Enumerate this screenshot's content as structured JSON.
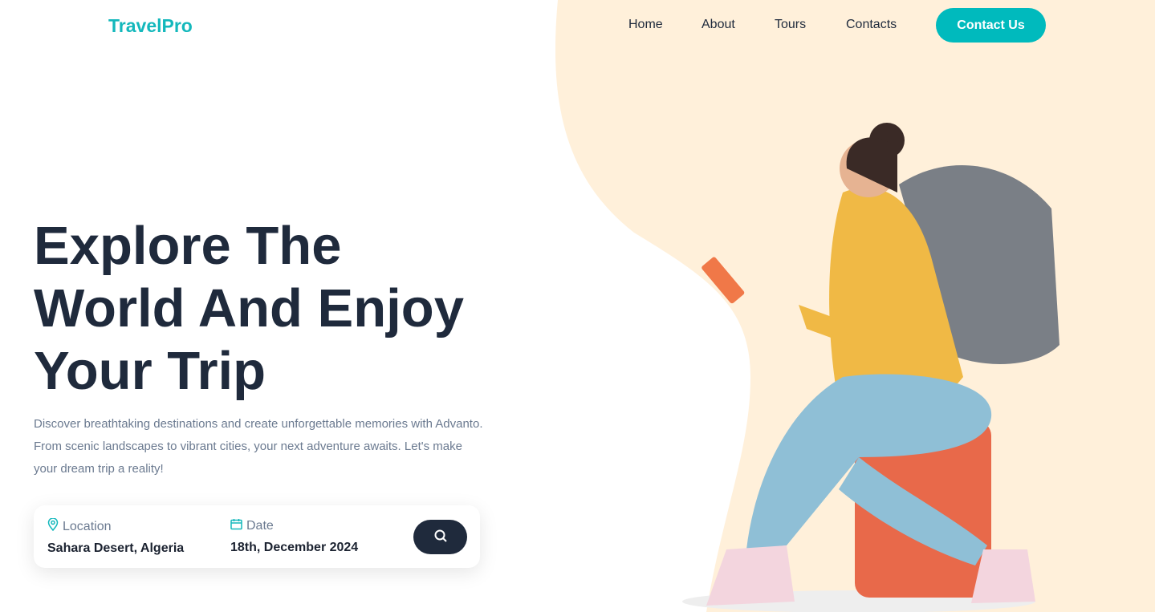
{
  "brand": "TravelPro",
  "nav": {
    "items": [
      "Home",
      "About",
      "Tours",
      "Contacts"
    ],
    "cta": "Contact Us"
  },
  "hero": {
    "title": "Explore The World And Enjoy Your Trip",
    "description": "Discover breathtaking destinations and create unforgettable memories with Advanto. From scenic landscapes to vibrant cities, your next adventure awaits. Let's make your dream trip a reality!"
  },
  "search": {
    "location_label": "Location",
    "location_value": "Sahara Desert, Algeria",
    "date_label": "Date",
    "date_value": "18th, December 2024",
    "icons": [
      "map-pin-icon",
      "calendar-icon",
      "search-icon"
    ]
  },
  "colors": {
    "accent": "#00babd",
    "dark": "#1f2a3c",
    "blob": "#fff0da"
  }
}
